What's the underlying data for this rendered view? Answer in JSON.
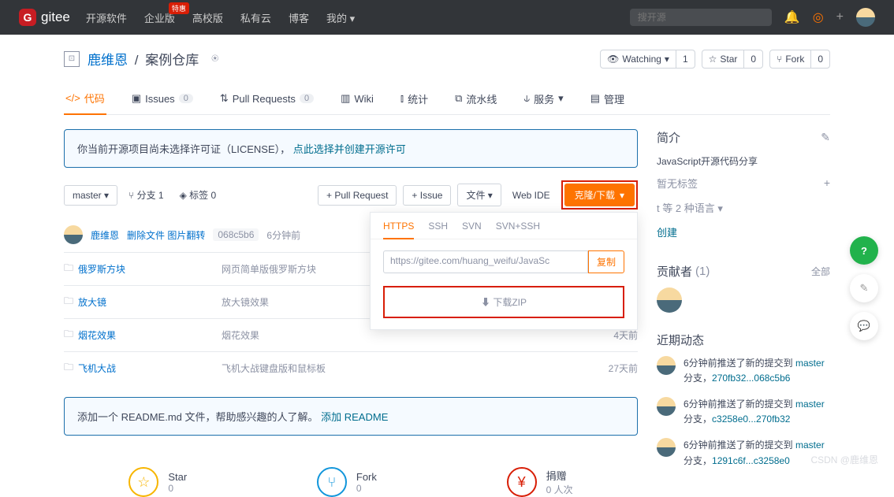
{
  "topbar": {
    "logo": "gitee",
    "nav": [
      "开源软件",
      "企业版",
      "高校版",
      "私有云",
      "博客",
      "我的"
    ],
    "hot_badge": "特惠",
    "search_placeholder": "搜开源"
  },
  "repo": {
    "owner": "鹿维恩",
    "name": "案例仓库",
    "watch_label": "Watching",
    "watch_count": "1",
    "star_label": "Star",
    "star_count": "0",
    "fork_label": "Fork",
    "fork_count": "0"
  },
  "tabs": {
    "code": "代码",
    "issues": "Issues",
    "issues_count": "0",
    "pr": "Pull Requests",
    "pr_count": "0",
    "wiki": "Wiki",
    "stats": "统计",
    "pipeline": "流水线",
    "service": "服务",
    "admin": "管理"
  },
  "license": {
    "text": "你当前开源项目尚未选择许可证（LICENSE），",
    "link": "点此选择并创建开源许可"
  },
  "toolbar": {
    "branch": "master",
    "branches": "分支 1",
    "tags": "标签 0",
    "pr_btn": "+ Pull Request",
    "issue_btn": "+ Issue",
    "file": "文件",
    "webide": "Web IDE",
    "clone": "克隆/下载"
  },
  "clone": {
    "tabs": [
      "HTTPS",
      "SSH",
      "SVN",
      "SVN+SSH"
    ],
    "url": "https://gitee.com/huang_weifu/JavaSc",
    "copy": "复制",
    "zip": "下载ZIP"
  },
  "commit": {
    "author": "鹿维恩",
    "action": "删除文件 图片翻转",
    "sha": "068c5b6",
    "time": "6分钟前"
  },
  "files": [
    {
      "name": "俄罗斯方块",
      "msg": "网页简单版俄罗斯方块",
      "time": ""
    },
    {
      "name": "放大镜",
      "msg": "放大镜效果",
      "time": ""
    },
    {
      "name": "烟花效果",
      "msg": "烟花效果",
      "time": "4天前"
    },
    {
      "name": "飞机大战",
      "msg": "飞机大战键盘版和鼠标板",
      "time": "27天前"
    }
  ],
  "readme": {
    "text": "添加一个 README.md 文件，帮助感兴趣的人了解。",
    "link": "添加 README"
  },
  "stats": {
    "star_label": "Star",
    "star_count": "0",
    "fork_label": "Fork",
    "fork_count": "0",
    "donate_label": "捐赠",
    "donate_count": "0 人次"
  },
  "side": {
    "intro_title": "简介",
    "intro_text": "JavaScript开源代码分享",
    "no_tags": "暂无标签",
    "lang_suffix": "等 2 种语言",
    "create": "创建",
    "contrib_title": "贡献者",
    "contrib_count": "(1)",
    "contrib_more": "全部",
    "activity_title": "近期动态",
    "activities": [
      {
        "t": "6分钟前推送了新的提交到",
        "b": "master",
        "s": "分支，",
        "h": "270fb32...068c5b6"
      },
      {
        "t": "6分钟前推送了新的提交到",
        "b": "master",
        "s": "分支，",
        "h": "c3258e0...270fb32"
      },
      {
        "t": "6分钟前推送了新的提交到",
        "b": "master",
        "s": "分支，",
        "h": "1291c6f...c3258e0"
      }
    ]
  },
  "watermark": "CSDN @鹿维恩"
}
